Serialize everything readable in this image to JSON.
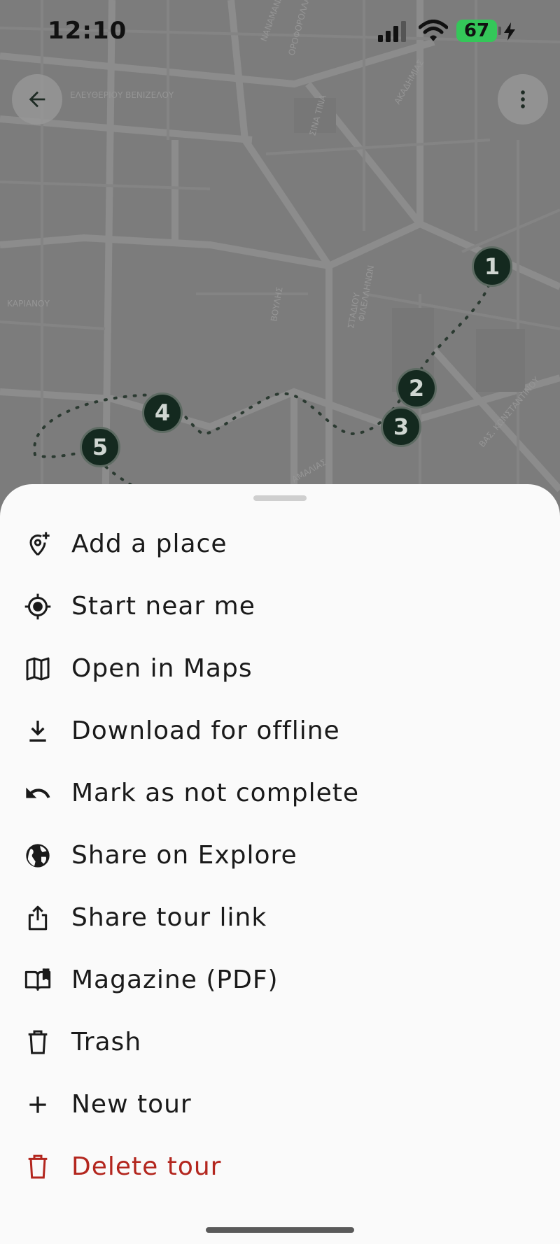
{
  "status_bar": {
    "time": "12:10",
    "battery": "67"
  },
  "map": {
    "street_labels": [
      "ΝΑΝΑΜΑΝΑ",
      "ΟΡΟΦΟΡΟΛΛΑΝ",
      "ΕΛΕΥΘΕΡΙΟΥ ΒΕΝΙΖΕΛΟΥ",
      "ΣΙΝΑ ΤΙΝΑ",
      "ΑΚΑΔΗΜΙΑΣ",
      "ΒΟΥΛΗΣ",
      "ΑΜΑΛΙΑΣ",
      "ΣΤΑΔΙΟΥ",
      "ΦΙΛΕΛΛΗΝΩΝ",
      "ΚΑΡΙΑΝΟΥ",
      "ΒΑΣ. ΚΩΝΣΤΑΝΤΙΝΟΥ"
    ],
    "markers": [
      "1",
      "2",
      "3",
      "4",
      "5"
    ]
  },
  "menu": [
    {
      "label": "Add a place",
      "icon": "add-location-icon"
    },
    {
      "label": "Start near me",
      "icon": "my-location-icon"
    },
    {
      "label": "Open in Maps",
      "icon": "map-icon"
    },
    {
      "label": "Download for offline",
      "icon": "download-icon"
    },
    {
      "label": "Mark as not complete",
      "icon": "undo-icon"
    },
    {
      "label": "Share on Explore",
      "icon": "globe-icon"
    },
    {
      "label": "Share tour link",
      "icon": "share-icon"
    },
    {
      "label": "Magazine (PDF)",
      "icon": "book-icon"
    },
    {
      "label": "Trash",
      "icon": "trash-icon"
    },
    {
      "label": "New tour",
      "icon": "plus-icon"
    },
    {
      "label": "Delete tour",
      "icon": "delete-icon",
      "color": "#b3261e"
    }
  ],
  "colors": {
    "marker_fill": "#14291f",
    "danger": "#b3261e",
    "battery": "#34c759"
  }
}
